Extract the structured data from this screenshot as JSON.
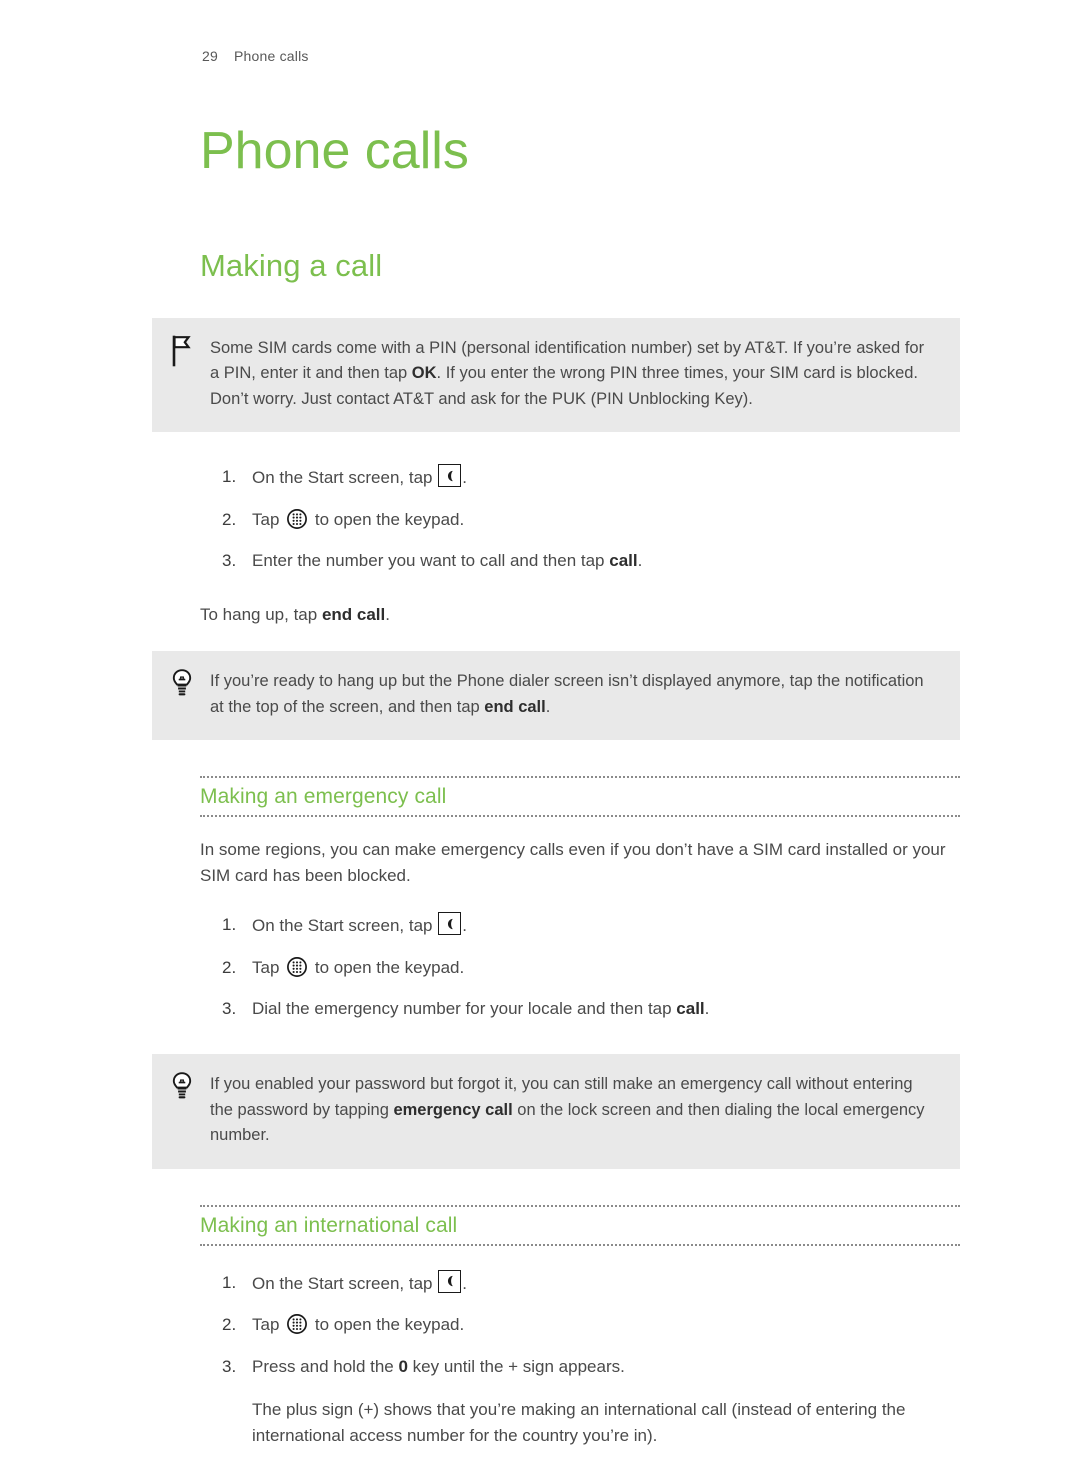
{
  "header": {
    "page_number": "29",
    "chapter_label": "Phone calls"
  },
  "chapter_title": "Phone calls",
  "colors": {
    "heading_green": "#7cbf4e",
    "callout_background": "#e9e9e9",
    "body_text": "#4a4a4a",
    "rule_dots": "#8b8b8b"
  },
  "section": {
    "title": "Making a call",
    "note_callout": {
      "icon": "flag-icon",
      "text_parts": [
        "Some SIM cards come with a PIN (personal identification number) set by AT&T. If you’re asked for a PIN, enter it and then tap ",
        "OK",
        ". If you enter the wrong PIN three times, your SIM card is blocked. Don’t worry. Just contact AT&T and ask for the PUK (PIN Unblocking Key)."
      ]
    },
    "steps": [
      {
        "parts": [
          "On the Start screen, tap ",
          "",
          "."
        ],
        "icon": "phone-handset-icon"
      },
      {
        "parts": [
          "Tap ",
          "",
          " to open the keypad."
        ],
        "icon": "keypad-icon"
      },
      {
        "parts": [
          "Enter the number you want to call and then tap ",
          "call",
          "."
        ],
        "icon": null
      }
    ],
    "hang_up_text_parts": [
      "To hang up, tap ",
      "end call",
      "."
    ],
    "tip_callout": {
      "icon": "lightbulb-icon",
      "text_parts": [
        "If you’re ready to hang up but the Phone dialer screen isn’t displayed anymore, tap the notification at the top of the screen, and then tap ",
        "end call",
        "."
      ]
    }
  },
  "emergency": {
    "title": "Making an emergency call",
    "intro": "In some regions, you can make emergency calls even if you don’t have a SIM card installed or your SIM card has been blocked.",
    "steps": [
      {
        "parts": [
          "On the Start screen, tap ",
          "",
          "."
        ],
        "icon": "phone-handset-icon"
      },
      {
        "parts": [
          "Tap ",
          "",
          " to open the keypad."
        ],
        "icon": "keypad-icon"
      },
      {
        "parts": [
          "Dial the emergency number for your locale and then tap ",
          "call",
          "."
        ],
        "icon": null
      }
    ],
    "tip_callout": {
      "icon": "lightbulb-icon",
      "text_parts": [
        "If you enabled your password but forgot it, you can still make an emergency call without entering the password by tapping ",
        "emergency call",
        " on the lock screen and then dialing the local emergency number."
      ]
    }
  },
  "international": {
    "title": "Making an international call",
    "steps": [
      {
        "parts": [
          "On the Start screen, tap ",
          "",
          "."
        ],
        "icon": "phone-handset-icon"
      },
      {
        "parts": [
          "Tap ",
          "",
          " to open the keypad."
        ],
        "icon": "keypad-icon"
      },
      {
        "parts": [
          "Press and hold the ",
          "0",
          " key until the + sign appears."
        ],
        "icon": null
      }
    ],
    "step_note": "The plus sign (+) shows that you’re making an international call (instead of entering the international access number for the country you’re in)."
  }
}
